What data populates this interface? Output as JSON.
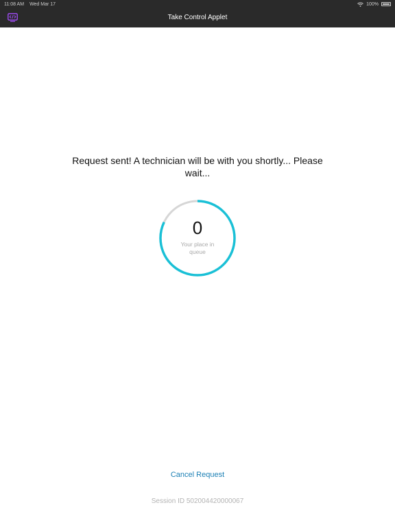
{
  "status_bar": {
    "time": "11:08 AM",
    "date": "Wed Mar 17",
    "battery": "100%"
  },
  "header": {
    "title": "Take Control Applet",
    "menu_icon": "code-window-icon",
    "accent_color": "#a64dff"
  },
  "main": {
    "message": "Request sent! A technician will be with you shortly... Please wait...",
    "queue": {
      "number": "0",
      "label": "Your place in queue",
      "progress": 0.82,
      "ring_color": "#1ac0d6",
      "track_color": "#d6d6d6"
    }
  },
  "footer": {
    "cancel_label": "Cancel Request",
    "session_id": "Session ID 502004420000067"
  }
}
